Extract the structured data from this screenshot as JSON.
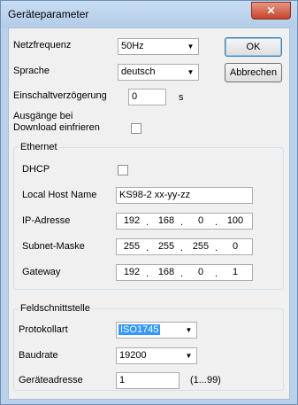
{
  "window": {
    "title": "Geräteparameter",
    "close_glyph": "✕"
  },
  "netzfrequenz": {
    "label": "Netzfrequenz",
    "value": "50Hz"
  },
  "sprache": {
    "label": "Sprache",
    "value": "deutsch"
  },
  "einschalt": {
    "label": "Einschaltverzögerung",
    "value": "0",
    "unit": "s"
  },
  "ausgaenge": {
    "label_line1": "Ausgänge bei",
    "label_line2": "Download einfrieren"
  },
  "buttons": {
    "ok": "OK",
    "cancel": "Abbrechen"
  },
  "ethernet": {
    "title": "Ethernet",
    "dhcp_label": "DHCP",
    "host_label": "Local Host Name",
    "host_value": "KS98-2 xx-yy-zz",
    "ip_label": "IP-Adresse",
    "ip": [
      "192",
      "168",
      "0",
      "100"
    ],
    "subnet_label": "Subnet-Maske",
    "subnet": [
      "255",
      "255",
      "255",
      "0"
    ],
    "gateway_label": "Gateway",
    "gateway": [
      "192",
      "168",
      "0",
      "1"
    ]
  },
  "feld": {
    "title": "Feldschnittstelle",
    "protokoll_label": "Protokollart",
    "protokoll_value": "ISO1745",
    "baud_label": "Baudrate",
    "baud_value": "19200",
    "addr_label": "Geräteadresse",
    "addr_value": "1",
    "addr_range": "(1...99)"
  },
  "icons": {
    "dropdown": "dropdown-arrow-icon",
    "close": "close-icon"
  }
}
